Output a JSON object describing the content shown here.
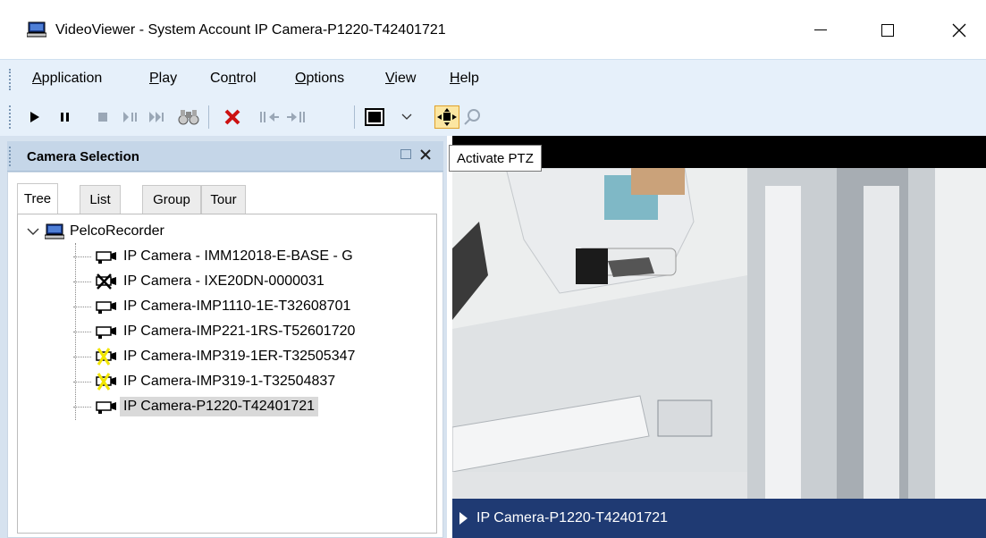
{
  "window": {
    "title": "VideoViewer - System Account IP Camera-P1220-T42401721",
    "minimize_label": "—",
    "maximize_label": "☐",
    "close_label": "✕"
  },
  "menu": {
    "items": [
      {
        "pre": "",
        "key": "A",
        "post": "pplication"
      },
      {
        "pre": "",
        "key": "P",
        "post": "lay"
      },
      {
        "pre": "Co",
        "key": "n",
        "post": "trol"
      },
      {
        "pre": "",
        "key": "O",
        "post": "ptions"
      },
      {
        "pre": "",
        "key": "V",
        "post": "iew"
      },
      {
        "pre": "",
        "key": "H",
        "post": "elp"
      }
    ]
  },
  "toolbar": {
    "icons": [
      "play-icon",
      "pause-icon",
      "stop-icon",
      "step-pause-icon",
      "fast-forward-icon",
      "binoculars-icon",
      "delete-icon",
      "step-back-icon",
      "step-forward-icon",
      "layout-icon",
      "dropdown-icon",
      "ptz-icon",
      "zoom-icon"
    ]
  },
  "panel": {
    "title": "Camera Selection",
    "tabs": [
      "Tree",
      "List",
      "Group",
      "Tour"
    ],
    "active_tab": "Tree"
  },
  "tree": {
    "root": "PelcoRecorder",
    "items": [
      {
        "label": "IP Camera - IMM12018-E-BASE - G",
        "status": "normal"
      },
      {
        "label": "IP Camera - IXE20DN-0000031",
        "status": "offline"
      },
      {
        "label": "IP Camera-IMP1110-1E-T32608701",
        "status": "normal"
      },
      {
        "label": "IP Camera-IMP221-1RS-T52601720",
        "status": "normal"
      },
      {
        "label": "IP Camera-IMP319-1ER-T32505347",
        "status": "warning"
      },
      {
        "label": "IP Camera-IMP319-1-T32504837",
        "status": "warning"
      },
      {
        "label": "IP Camera-P1220-T42401721",
        "status": "selected"
      }
    ]
  },
  "video": {
    "tooltip": "Activate PTZ",
    "caption": "IP Camera-P1220-T42401721"
  },
  "colors": {
    "menubar_bg": "#e6f0fa",
    "panel_bg": "#d6e2ef",
    "caption_bg": "#1f3a73",
    "selection_bg": "#d9d9d9"
  }
}
